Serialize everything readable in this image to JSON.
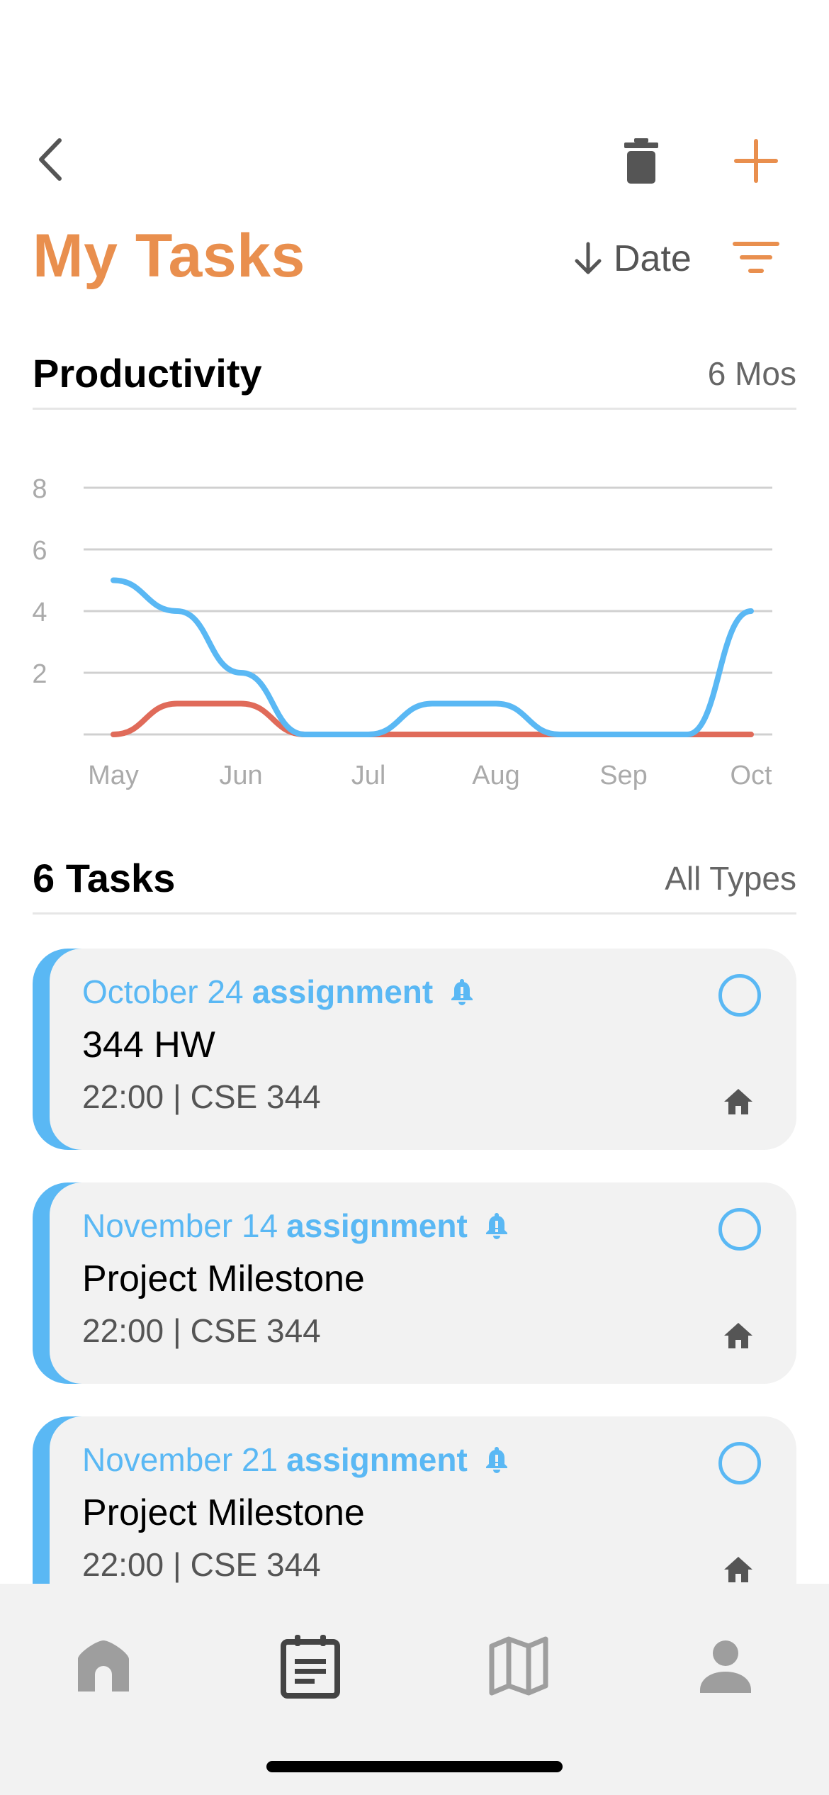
{
  "header": {
    "title": "My Tasks",
    "sort_label": "Date"
  },
  "productivity": {
    "title": "Productivity",
    "range_label": "6 Mos"
  },
  "chart_data": {
    "type": "line",
    "x_ticks": [
      "May",
      "Jun",
      "Jul",
      "Aug",
      "Sep",
      "Oct"
    ],
    "y_ticks": [
      "2",
      "4",
      "6",
      "8"
    ],
    "ylim": [
      0,
      8
    ],
    "grid": true,
    "series": [
      {
        "color": "#5AB8F4",
        "x": [
          0,
          0.5,
          1,
          1.5,
          2,
          2.5,
          3,
          3.5,
          4,
          4.5,
          5
        ],
        "values": [
          5,
          4,
          2,
          0,
          0,
          1,
          1,
          0,
          0,
          0,
          4
        ]
      },
      {
        "color": "#E06B5A",
        "x": [
          0,
          0.5,
          1,
          1.5,
          2,
          2.5,
          3,
          3.5,
          4,
          4.5,
          5
        ],
        "values": [
          0,
          1,
          1,
          0,
          0,
          0,
          0,
          0,
          0,
          0,
          0
        ]
      }
    ]
  },
  "tasks_section": {
    "title": "6 Tasks",
    "filter_label": "All Types"
  },
  "tasks": [
    {
      "date": "October 24",
      "type": "assignment",
      "title": "344 HW",
      "meta": "22:00 | CSE 344"
    },
    {
      "date": "November 14",
      "type": "assignment",
      "title": "Project Milestone",
      "meta": "22:00 | CSE 344"
    },
    {
      "date": "November 21",
      "type": "assignment",
      "title": "Project Milestone",
      "meta": "22:00 | CSE 344"
    }
  ],
  "icons": {
    "back": "chevron-left-icon",
    "trash": "trash-icon",
    "add": "plus-icon",
    "sort": "arrow-down-icon",
    "filter": "filter-icon",
    "bell": "bell-icon",
    "home": "home-icon",
    "nav": [
      "home-icon",
      "calendar-tasks-icon",
      "map-icon",
      "person-icon"
    ]
  },
  "colors": {
    "accent": "#E98F4E",
    "blue": "#5AB8F4",
    "red": "#E06B5A",
    "nav_active": "#444444",
    "nav_inactive": "#9E9E9E"
  }
}
